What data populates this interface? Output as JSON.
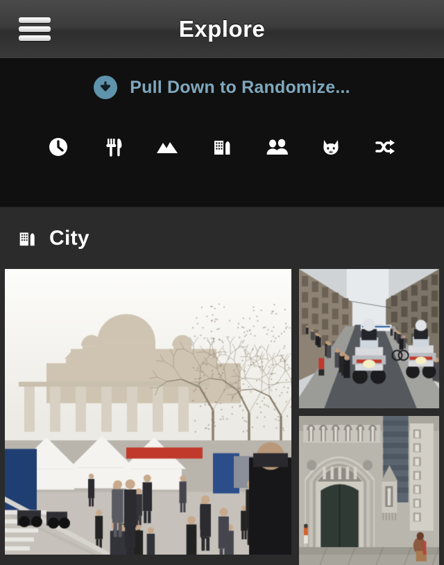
{
  "navbar": {
    "menu_icon": "hamburger-menu-icon",
    "title": "Explore"
  },
  "pull_to_refresh": {
    "icon": "arrow-down-circle-icon",
    "label": "Pull Down to Randomize...",
    "accent_color": "#7fa8bd",
    "icon_bg_color": "#5f93ab"
  },
  "categories": [
    {
      "name": "recent",
      "icon": "clock-icon"
    },
    {
      "name": "food",
      "icon": "fork-knife-icon"
    },
    {
      "name": "nature",
      "icon": "mountains-icon"
    },
    {
      "name": "city",
      "icon": "buildings-icon"
    },
    {
      "name": "people",
      "icon": "people-icon"
    },
    {
      "name": "animals",
      "icon": "cat-icon"
    },
    {
      "name": "random",
      "icon": "shuffle-icon"
    }
  ],
  "section": {
    "icon": "buildings-icon",
    "title": "City"
  },
  "photos": [
    {
      "position": "main",
      "description": "Crowd walking toward a large domed palace on a plaza with bare trees and white event tents"
    },
    {
      "position": "side-top",
      "description": "Police motorcycles riding down a narrow city street lined with pedestrians and stone buildings"
    },
    {
      "position": "side-bottom",
      "description": "Ornate Gothic cathedral stone portal with carved statues and a dark wooden door"
    }
  ],
  "theme": {
    "page_background": "#0d0d0d",
    "section_background": "#2b2b2b",
    "navbar_text": "#ffffff"
  }
}
